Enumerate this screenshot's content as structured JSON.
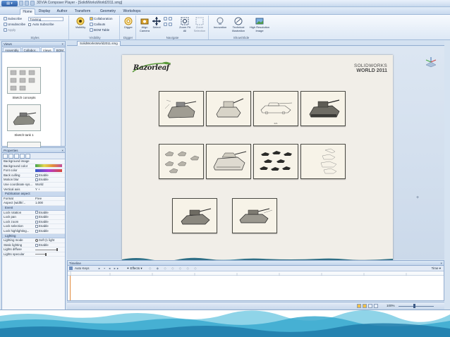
{
  "window": {
    "title": "3DVIA Composer Player - [SolidWorksWorld2011.smg]",
    "app_menu_label": "▤ ▾"
  },
  "tabs": [
    "Home",
    "Display",
    "Author",
    "Transform",
    "Geometry",
    "Workshops"
  ],
  "ribbon": {
    "groups": {
      "styles": "Styles",
      "visibility": "Visibility",
      "digger": "Digger",
      "navigate": "Navigate",
      "showslide": "Show/Slide"
    },
    "styles_items": [
      "Subscribe",
      "Unsubscribe",
      "Apply"
    ],
    "styles_dropdown": "Training",
    "styles_check": "Auto Subscribe",
    "visibility_big": "Visibility",
    "visibility_items": [
      "Collaboration",
      "Callouts",
      "BOM Table"
    ],
    "digger_big": "Digger",
    "nav_big": [
      "Align Camera",
      "Select",
      "Zoom Fit All",
      "Zoom Selection"
    ],
    "show_big": [
      "Innovation",
      "Technical Illustration",
      "High Resolution Image"
    ]
  },
  "views_panel": {
    "title": "Views",
    "tabs": [
      "Assembly",
      "Collabor...",
      "Views",
      "BOM"
    ],
    "items": [
      {
        "label": "Sketch concepts"
      },
      {
        "label": "Sketch tank 1"
      }
    ]
  },
  "properties": {
    "title": "Properties",
    "rows": [
      {
        "k": "Background image",
        "v": ""
      },
      {
        "k": "Background color",
        "v": ""
      },
      {
        "k": "Font color",
        "v": ""
      },
      {
        "k": "Back culling",
        "v": "Enable"
      },
      {
        "k": "Motion blur",
        "v": "Enable"
      },
      {
        "k": "Use coordinate sys...",
        "v": "World"
      },
      {
        "k": "Vertical axis",
        "v": "Y +"
      }
    ],
    "sec1": "Publication aspect",
    "rows2": [
      {
        "k": "Format",
        "v": "Free"
      },
      {
        "k": "Aspect (width/...",
        "v": "1.000"
      }
    ],
    "sec2": "Event",
    "rows3": [
      {
        "k": "Lock rotation",
        "v": "Enable"
      },
      {
        "k": "Lock pan",
        "v": "Enable"
      },
      {
        "k": "Lock zoom",
        "v": "Enable"
      },
      {
        "k": "Lock selection",
        "v": "Enable"
      },
      {
        "k": "Lock highlighting...",
        "v": "Enable"
      }
    ],
    "sec3": "Lighting",
    "rows4": [
      {
        "k": "Lighting mode",
        "v": "Soft (1 light"
      },
      {
        "k": "Static lighting",
        "v": "Enable"
      },
      {
        "k": "Lights diffuse",
        "v": ""
      },
      {
        "k": "Lights specular",
        "v": ""
      }
    ]
  },
  "doc_tab": "SolidWorksWorld2011.smg",
  "page": {
    "logo": "Razorleaf",
    "brand_line1": "SOLIDWORKS",
    "brand_line2": "WORLD 2011",
    "thumb_caption": "221"
  },
  "timeline": {
    "title": "Timeline",
    "auto_keys": "Auto Keys",
    "effects": "Effects",
    "time": "Time"
  },
  "status": {
    "zoom": "100%"
  }
}
